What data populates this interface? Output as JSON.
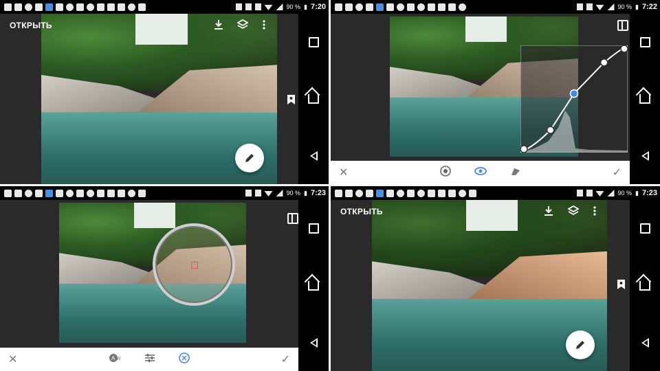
{
  "status": {
    "q1": {
      "battery": "90 %",
      "time": "7:20"
    },
    "q2": {
      "battery": "90 %",
      "time": "7:22"
    },
    "q3": {
      "battery": "90 %",
      "time": "7:23"
    },
    "q4": {
      "battery": "90 %",
      "time": "7:23"
    }
  },
  "q1": {
    "open_label": "ОТКРЫТЬ"
  },
  "q4": {
    "open_label": "ОТКРЫТЬ"
  },
  "curves": {
    "points": [
      [
        0.0,
        0.0
      ],
      [
        0.28,
        0.21
      ],
      [
        0.5,
        0.55
      ],
      [
        0.78,
        0.84
      ],
      [
        1.0,
        1.0
      ]
    ],
    "active_point": 2,
    "active_color": "#4a86e8"
  },
  "q2_toolbar": {
    "tools": [
      "palette-icon",
      "eye-icon",
      "brush-icon"
    ],
    "active_tool": "eye-icon"
  },
  "q3_toolbar": {
    "tools": [
      "auto-wb-icon",
      "sliders-icon",
      "target-icon"
    ],
    "active_tool": "target-icon"
  },
  "colors": {
    "accent": "#4a86e8",
    "nav": "#000000",
    "panel": "#2a2a2a"
  }
}
